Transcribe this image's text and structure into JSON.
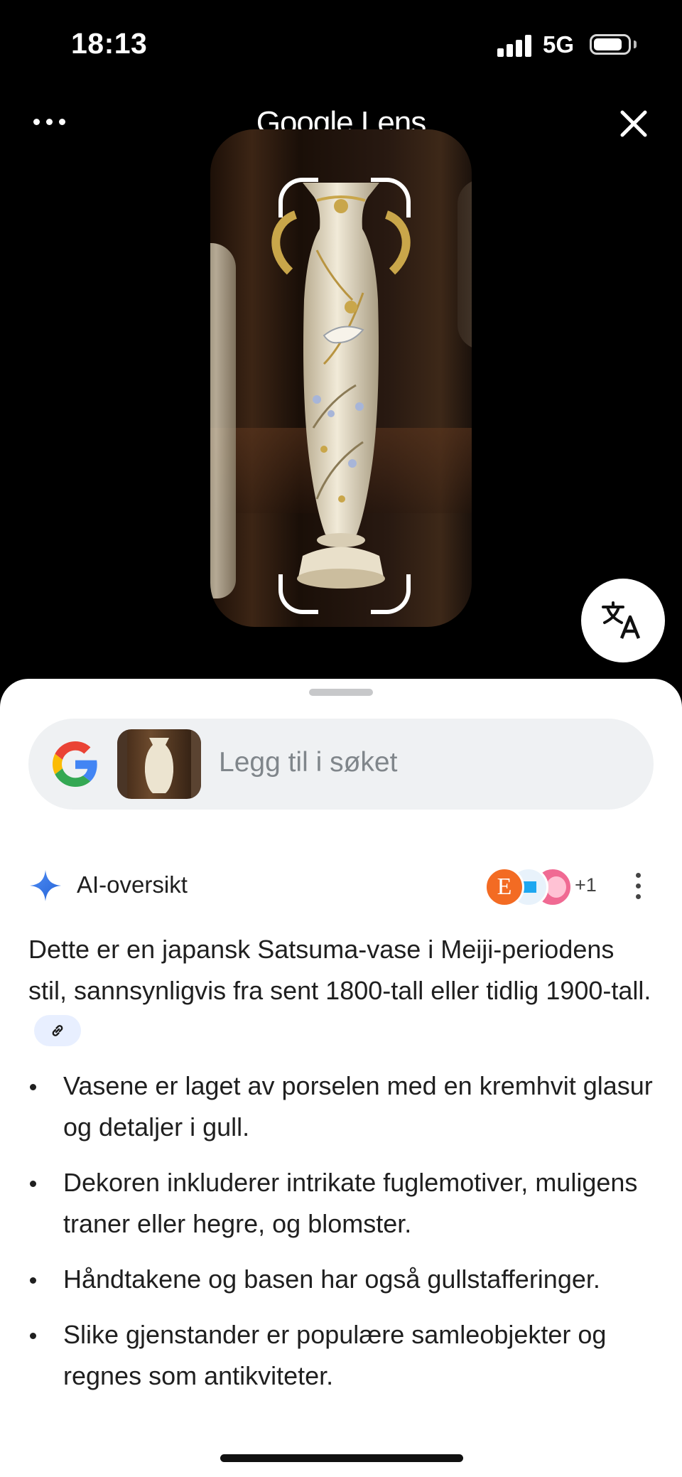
{
  "status_bar": {
    "time": "18:13",
    "network": "5G",
    "battery_level": 0.85
  },
  "header": {
    "title": "Google Lens"
  },
  "search": {
    "placeholder": "Legg til i søket"
  },
  "ai_overview": {
    "title": "AI-oversikt",
    "source_extra_count": "+1",
    "avatar_letter": "E",
    "intro": "Dette er en japansk Satsuma-vase i Meiji-periodens stil, sannsynligvis fra sent 1800-tall eller tidlig 1900-tall.",
    "bullets": [
      "Vasene er laget av porselen med en kremhvit glasur og detaljer i gull.",
      "Dekoren inkluderer intrikate fuglemotiver, muligens traner eller hegre, og blomster.",
      "Håndtakene og basen har også gullstafferinger.",
      "Slike gjenstander er populære samleobjekter og regnes som antikviteter."
    ]
  },
  "icons": {
    "more": "more-horizontal-icon",
    "close": "close-icon",
    "translate": "translate-icon",
    "google": "google-g-icon",
    "sparkle": "sparkle-icon",
    "link": "link-icon",
    "kebab": "more-vertical-icon"
  },
  "colors": {
    "google_blue": "#4285F4",
    "google_red": "#EA4335",
    "google_yellow": "#FBBC05",
    "google_green": "#34A853",
    "sheet_bg": "#FFFFFF"
  }
}
